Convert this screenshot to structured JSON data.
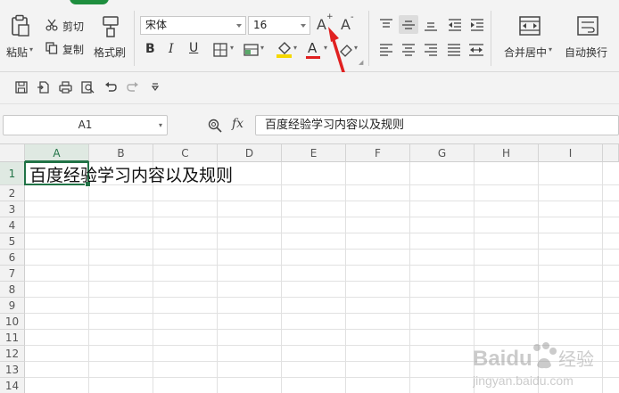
{
  "ribbon": {
    "paste_label": "粘贴",
    "cut_label": "剪切",
    "copy_label": "复制",
    "format_painter_label": "格式刷",
    "font_name": "宋体",
    "font_size": "16",
    "bold_label": "B",
    "italic_label": "I",
    "underline_label": "U",
    "font_color_label": "A",
    "increase_font_label": "A",
    "decrease_font_label": "A",
    "merge_center_label": "合并居中",
    "wrap_text_label": "自动换行"
  },
  "formula_bar": {
    "name_box": "A1",
    "fx_label": "fx",
    "formula": "百度经验学习内容以及规则"
  },
  "grid": {
    "columns": [
      "A",
      "B",
      "C",
      "D",
      "E",
      "F",
      "G",
      "H",
      "I"
    ],
    "rows": [
      "1",
      "2",
      "3",
      "4",
      "5",
      "6",
      "7",
      "8",
      "9",
      "10",
      "11",
      "12",
      "13",
      "14"
    ],
    "a1_value": "百度经验学习内容以及规则"
  },
  "watermark": {
    "brand": "Baidu",
    "brand_cn": "经验",
    "url": "jingyan.baidu.com"
  },
  "colors": {
    "accent_green": "#217346",
    "tab_green": "#1e8e3e",
    "arrow_red": "#e02020",
    "font_color_red": "#e02020",
    "highlight_yellow": "#f5d800"
  },
  "icons": [
    "scissors-icon",
    "copy-icon",
    "paste-icon",
    "format-painter-icon",
    "save-icon",
    "export-icon",
    "print-icon",
    "print-preview-icon",
    "undo-icon",
    "redo-icon",
    "customize-icon",
    "zoom-icon"
  ]
}
